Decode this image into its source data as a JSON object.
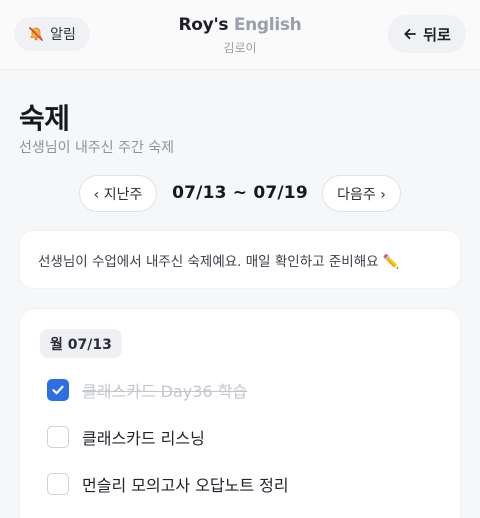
{
  "header": {
    "alarm_label": "알림",
    "brand_primary": "Roy's",
    "brand_secondary": "English",
    "student_name": "김로이",
    "back_label": "뒤로"
  },
  "page": {
    "title": "숙제",
    "subtitle": "선생님이 내주신 주간 숙제"
  },
  "week_nav": {
    "prev_label": "‹ 지난주",
    "range": "07/13 ~ 07/19",
    "next_label": "다음주 ›"
  },
  "info": {
    "message": "선생님이 수업에서 내주신 숙제예요. 매일 확인하고 준비해요 ✏️"
  },
  "days": [
    {
      "label": "월 07/13",
      "tasks": [
        {
          "label": "클래스카드 Day36 학습",
          "done": true
        },
        {
          "label": "클래스카드 리스닝",
          "done": false
        },
        {
          "label": "먼슬리 모의고사 오답노트 정리",
          "done": false
        }
      ]
    }
  ],
  "colors": {
    "accent": "#2f6fe4",
    "brand_secondary": "#98a0ab"
  }
}
